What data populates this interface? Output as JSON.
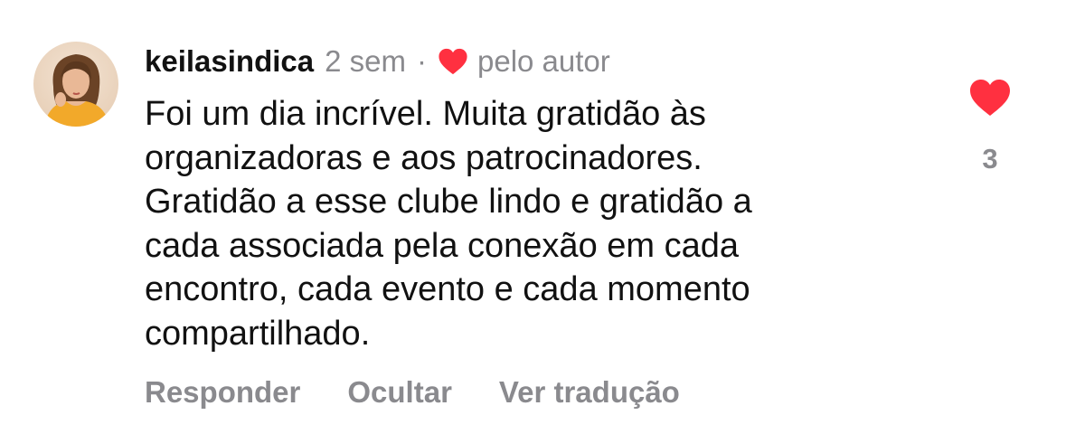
{
  "comment": {
    "username": "keilasindica",
    "time": "2 sem",
    "separator": "·",
    "liked_by_author_label": "pelo autor",
    "body_lines": [
      "Foi um dia incrível. Muita gratidão às",
      "organizadoras e aos patrocinadores.",
      "Gratidão a esse clube lindo e gratidão a",
      "cada associada pela conexão em cada",
      "encontro, cada evento e cada momento",
      "compartilhado."
    ],
    "actions": {
      "reply": "Responder",
      "hide": "Ocultar",
      "translate": "Ver tradução"
    },
    "likes": {
      "count": "3",
      "icon": "heart-filled-icon",
      "color": "#ff3040"
    }
  },
  "colors": {
    "text": "#111111",
    "secondary": "#8a8a8e",
    "heart": "#ff3040"
  }
}
